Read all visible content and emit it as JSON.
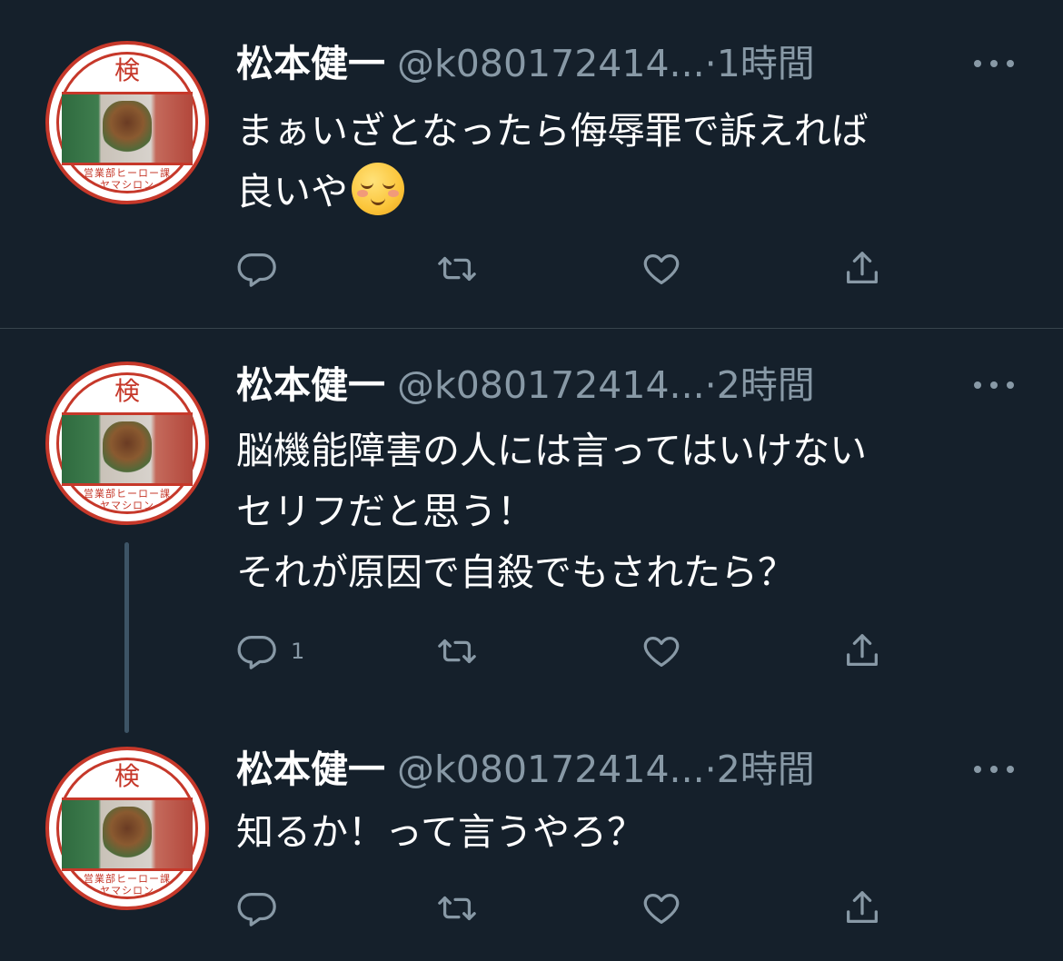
{
  "tweets": [
    {
      "author_name": "松本健一",
      "handle": "@k080172414...",
      "separator": "·",
      "time": "1時間",
      "text": "まぁいざとなったら侮辱罪で訴えれば\n良いや",
      "emoji": "smiling-face-icon",
      "reply_count": "",
      "avatar": {
        "top_char": "検",
        "caption_line1": "営業部ヒーロー課",
        "caption_line2": "ヤマシロン"
      }
    },
    {
      "author_name": "松本健一",
      "handle": "@k080172414...",
      "separator": "·",
      "time": "2時間",
      "text": "脳機能障害の人には言ってはいけない\nセリフだと思う！\nそれが原因で自殺でもされたら？",
      "reply_count": "1",
      "avatar": {
        "top_char": "検",
        "caption_line1": "営業部ヒーロー課",
        "caption_line2": "ヤマシロン"
      }
    },
    {
      "author_name": "松本健一",
      "handle": "@k080172414...",
      "separator": "·",
      "time": "2時間",
      "text": "知るか！って言うやろ？",
      "reply_count": "",
      "avatar": {
        "top_char": "検",
        "caption_line1": "営業部ヒーロー課",
        "caption_line2": "ヤマシロン"
      }
    }
  ],
  "colors": {
    "background": "#15202b",
    "text_primary": "#ffffff",
    "text_secondary": "#8899a6",
    "divider": "#38444d",
    "thread_line": "#3d5466",
    "avatar_red": "#c6382a"
  }
}
